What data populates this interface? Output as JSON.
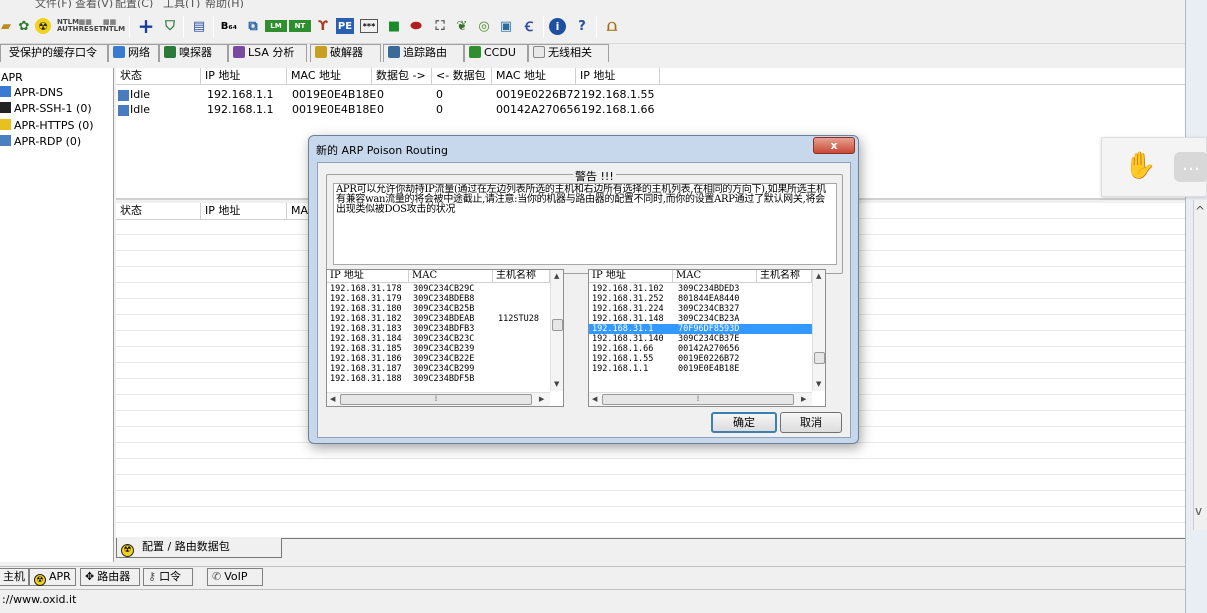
{
  "menu": {
    "items": [
      "文件(F)",
      "查看(V)",
      "配置(C)",
      "工具(T)",
      "帮助(H)"
    ]
  },
  "toolbar": {
    "icons": [
      "open-icon",
      "plugin-icon",
      "radioactive-icon",
      "ntlm-auth-icon",
      "reset-icon",
      "ntlm-icon",
      "add-icon",
      "shield-icon",
      "decode-icon",
      "base64-icon",
      "network-icon",
      "lm-icon",
      "hash-icon",
      "wireless-icon",
      "cisco-icon",
      "monitor-icon",
      "chat-icon",
      "keys-icon",
      "disc-icon",
      "config-icon",
      "wifi-icon",
      "info-icon",
      "help-icon",
      "portal-icon"
    ]
  },
  "tabs": [
    {
      "label": "受保护的缓存口令",
      "icon": ""
    },
    {
      "label": "网络",
      "icon": "network-icon"
    },
    {
      "label": "嗅探器",
      "icon": "sniffer-icon"
    },
    {
      "label": "LSA 分析",
      "icon": "lsa-icon"
    },
    {
      "label": "破解器",
      "icon": "cracker-icon"
    },
    {
      "label": "追踪路由",
      "icon": "traceroute-icon"
    },
    {
      "label": "CCDU",
      "icon": "ccdu-icon"
    },
    {
      "label": "无线相关",
      "icon": "wireless-icon"
    }
  ],
  "tree": {
    "items": [
      {
        "label": "APR",
        "icon": ""
      },
      {
        "label": "APR-DNS",
        "icon": "dns-icon"
      },
      {
        "label": "APR-SSH-1 (0)",
        "icon": "terminal-icon"
      },
      {
        "label": "APR-HTTPS (0)",
        "icon": "lock-icon"
      },
      {
        "label": "APR-RDP (0)",
        "icon": "rdp-icon"
      }
    ]
  },
  "upper_table": {
    "columns": [
      "状态",
      "IP 地址",
      "MAC 地址",
      "数据包 ->",
      "<- 数据包",
      "MAC 地址",
      "IP 地址"
    ],
    "rows": [
      [
        "Idle",
        "192.168.1.1",
        "0019E0E4B18E",
        "0",
        "0",
        "0019E0226B72",
        "192.168.1.55"
      ],
      [
        "Idle",
        "192.168.1.1",
        "0019E0E4B18E",
        "0",
        "0",
        "00142A270656",
        "192.168.1.66"
      ]
    ]
  },
  "lower_table": {
    "columns": [
      "状态",
      "IP 地址",
      "MA"
    ]
  },
  "bottom_tab": {
    "label": "配置 / 路由数据包"
  },
  "status_tabs": [
    {
      "label": "主机",
      "icon": ""
    },
    {
      "label": "APR",
      "icon": "radioactive-icon"
    },
    {
      "label": "路由器",
      "icon": "router-icon"
    },
    {
      "label": "口令",
      "icon": "key-icon"
    },
    {
      "label": "VoIP",
      "icon": "voip-icon"
    }
  ],
  "statusbar": {
    "text": "://www.oxid.it"
  },
  "dialog": {
    "title": "新的 ARP Poison Routing",
    "close_label": "x",
    "warning_title": "警告 !!!",
    "warning_text": "APR可以允许你劫持IP流量(通过在左边列表所选的主机和右边所有选择的主机列表,在相同的方向下),如果所选主机有兼容wan流量的将会被中途截止,请注意:当你的机器与路由器的配置不同时,而你的设置ARP通过了默认网关,将会出现类似被DOS攻击的状况",
    "left_list": {
      "columns": [
        "IP 地址",
        "MAC",
        "主机名称"
      ],
      "rows": [
        [
          "192.168.31.178",
          "309C234CB29C",
          ""
        ],
        [
          "192.168.31.179",
          "309C234BDEB8",
          ""
        ],
        [
          "192.168.31.180",
          "309C234CB25B",
          ""
        ],
        [
          "192.168.31.182",
          "309C234BDEAB",
          "112STU28"
        ],
        [
          "192.168.31.183",
          "309C234BDFB3",
          ""
        ],
        [
          "192.168.31.184",
          "309C234CB23C",
          ""
        ],
        [
          "192.168.31.185",
          "309C234CB239",
          ""
        ],
        [
          "192.168.31.186",
          "309C234CB22E",
          ""
        ],
        [
          "192.168.31.187",
          "309C234CB299",
          ""
        ],
        [
          "192.168.31.188",
          "309C234BDF5B",
          ""
        ]
      ]
    },
    "right_list": {
      "columns": [
        "IP 地址",
        "MAC",
        "主机名称"
      ],
      "rows": [
        [
          "192.168.31.102",
          "309C234BDED3",
          ""
        ],
        [
          "192.168.31.252",
          "801844EA8440",
          ""
        ],
        [
          "192.168.31.224",
          "309C234CB327",
          ""
        ],
        [
          "192.168.31.148",
          "309C234CB23A",
          ""
        ],
        [
          "192.168.31.1",
          "70F96DF8593D",
          ""
        ],
        [
          "192.168.31.140",
          "309C234CB37E",
          ""
        ],
        [
          "192.168.1.66",
          "00142A270656",
          ""
        ],
        [
          "192.168.1.55",
          "0019E0226B72",
          ""
        ],
        [
          "192.168.1.1",
          "0019E0E4B18E",
          ""
        ]
      ],
      "selected_row": 4
    },
    "ok_label": "确定",
    "cancel_label": "取消"
  }
}
